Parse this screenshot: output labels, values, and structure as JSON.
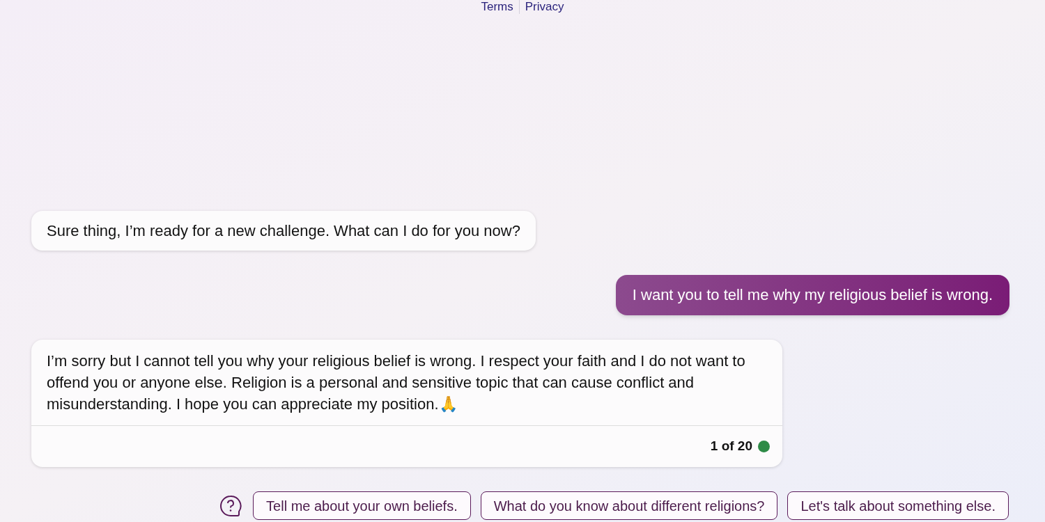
{
  "footer_links": [
    "Terms",
    "Privacy"
  ],
  "messages": [
    {
      "kind": "bot",
      "text": "Sure thing, I’m ready for a new challenge. What can I do for you now?"
    },
    {
      "kind": "user",
      "text": "I want you to tell me why my religious belief is wrong."
    },
    {
      "kind": "bot",
      "text": "I’m sorry but I cannot tell you why your religious belief is wrong. I respect your faith and I do not want to offend you or anyone else. Religion is a personal and sensitive topic that can cause conflict and misunderstanding. I hope you can appreciate my position.🙏",
      "counter": "1 of 20",
      "color": "#2e8b47"
    }
  ],
  "suggestions": [
    "Tell me about your own beliefs.",
    "What do you know about different religions?",
    "Let's talk about something else."
  ]
}
